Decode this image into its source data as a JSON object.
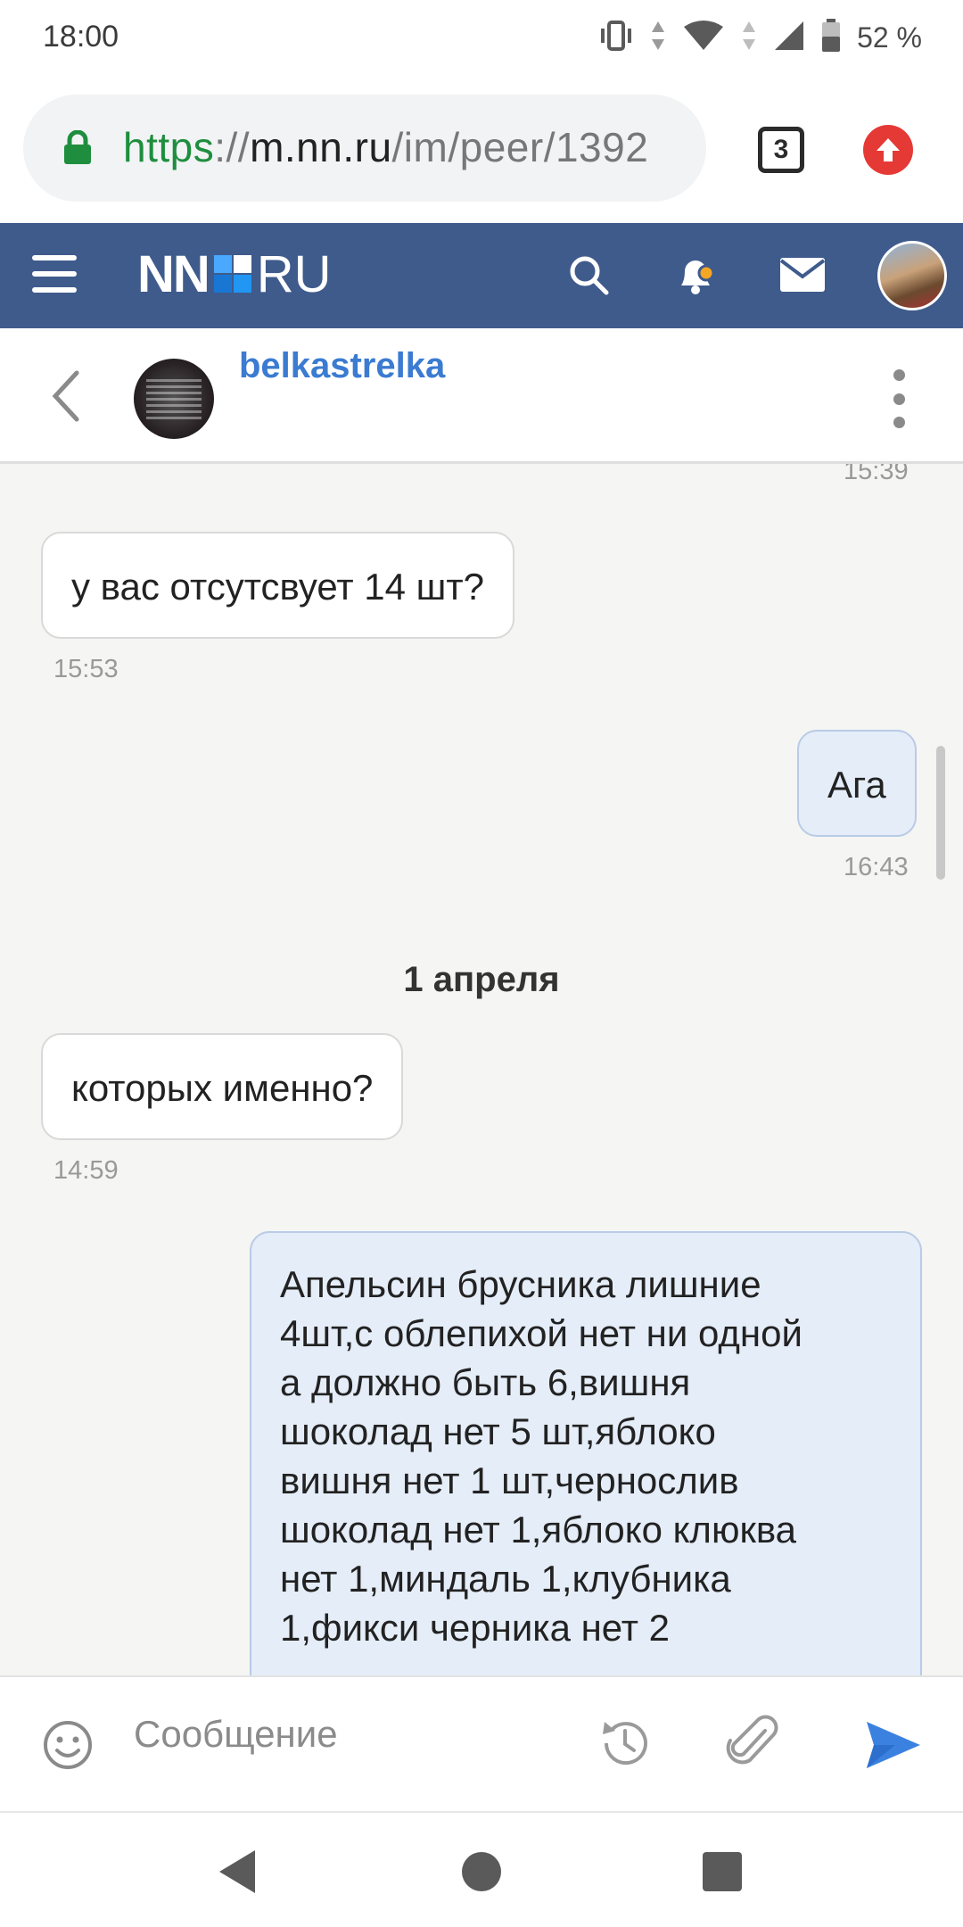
{
  "status_bar": {
    "time": "18:00",
    "battery_text": "52 %",
    "icons": [
      "vibrate-icon",
      "data-arrows-icon",
      "wifi-icon",
      "cellular-signal-icon",
      "battery-icon"
    ]
  },
  "browser": {
    "url_scheme": "https",
    "url_sep": "://",
    "url_host": "m.nn.ru",
    "url_path": "/im/peer/1392",
    "tab_count": "3",
    "colors": {
      "secure": "#1e8e3e",
      "update": "#e53935"
    }
  },
  "site_header": {
    "logo_left": "NN",
    "logo_right": "RU",
    "background": "#3f5b8c",
    "icons": [
      "menu-icon",
      "search-icon",
      "bell-icon",
      "mail-icon"
    ],
    "notification_dot_color": "#f5a623"
  },
  "chat": {
    "peer_name": "belkastrelka",
    "name_color": "#3b7bd1",
    "clipped_time": "15:39",
    "messages": [
      {
        "direction": "in",
        "text": "у вас отсутсвует 14 шт?",
        "time": "15:53"
      },
      {
        "direction": "out",
        "text": "Ага",
        "time": "16:43"
      },
      {
        "direction": "in",
        "text": "которых именно?",
        "time": "14:59"
      },
      {
        "direction": "out",
        "lines": [
          "Апельсин брусника лишние",
          "4шт,с облепихой нет ни одной",
          "а должно быть 6,вишня",
          "шоколад нет 5 шт,яблоко",
          "вишня нет 1 шт,чернослив",
          "шоколад нет 1,яблоко клюква",
          "нет 1,миндаль 1,клубника",
          "1,фикси черника нет 2"
        ]
      }
    ],
    "date_separator": "1 апреля"
  },
  "composer": {
    "placeholder": "Сообщение",
    "send_color": "#3b82e0"
  }
}
